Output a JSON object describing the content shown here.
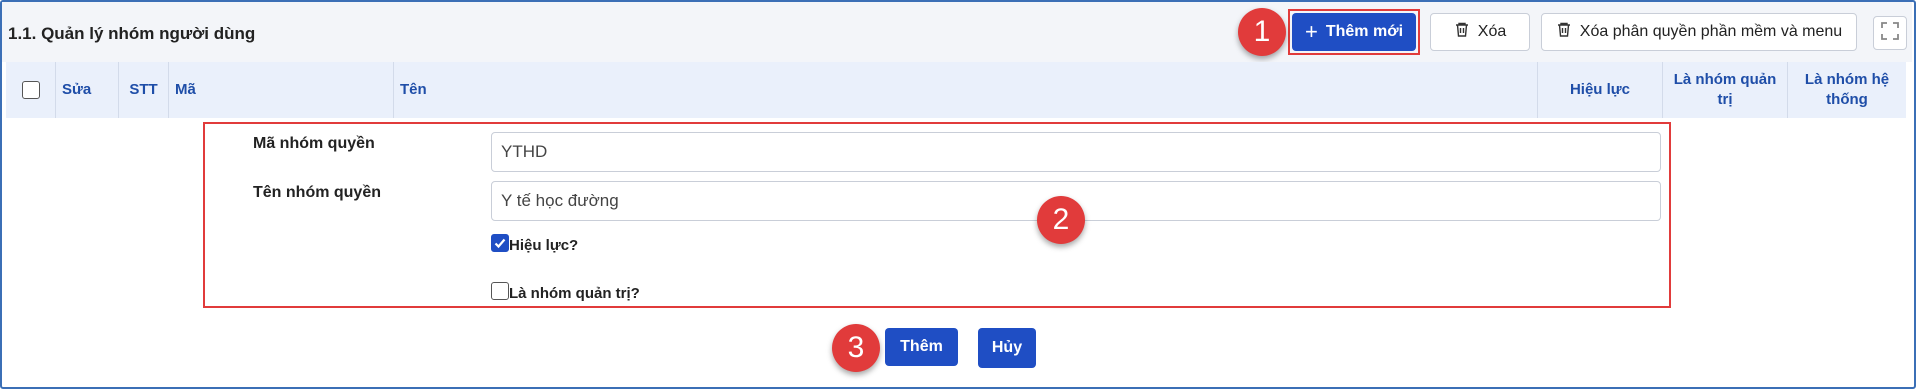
{
  "page": {
    "title": "1.1. Quản lý nhóm người dùng"
  },
  "toolbar": {
    "add_label": "Thêm mới",
    "delete_label": "Xóa",
    "delete_permissions_label": "Xóa phân quyền phần mềm và menu"
  },
  "table": {
    "columns": [
      "Sửa",
      "STT",
      "Mã",
      "Tên",
      "Hiệu lực",
      "Là nhóm quản trị",
      "Là nhóm hệ thống"
    ]
  },
  "form": {
    "code_label": "Mã nhóm quyền",
    "code_value": "YTHD",
    "name_label": "Tên nhóm quyền",
    "name_value": "Y tế học đường",
    "active_label": "Hiệu lực?",
    "active_checked": true,
    "admin_label": "Là nhóm quản trị?",
    "admin_checked": false,
    "submit_label": "Thêm",
    "cancel_label": "Hủy"
  },
  "markers": [
    "1",
    "2",
    "3"
  ],
  "colors": {
    "primary": "#1f4ec4",
    "highlight": "#e13b3b",
    "header_bg": "#eaf0fb",
    "header_text": "#1f4ea8"
  }
}
